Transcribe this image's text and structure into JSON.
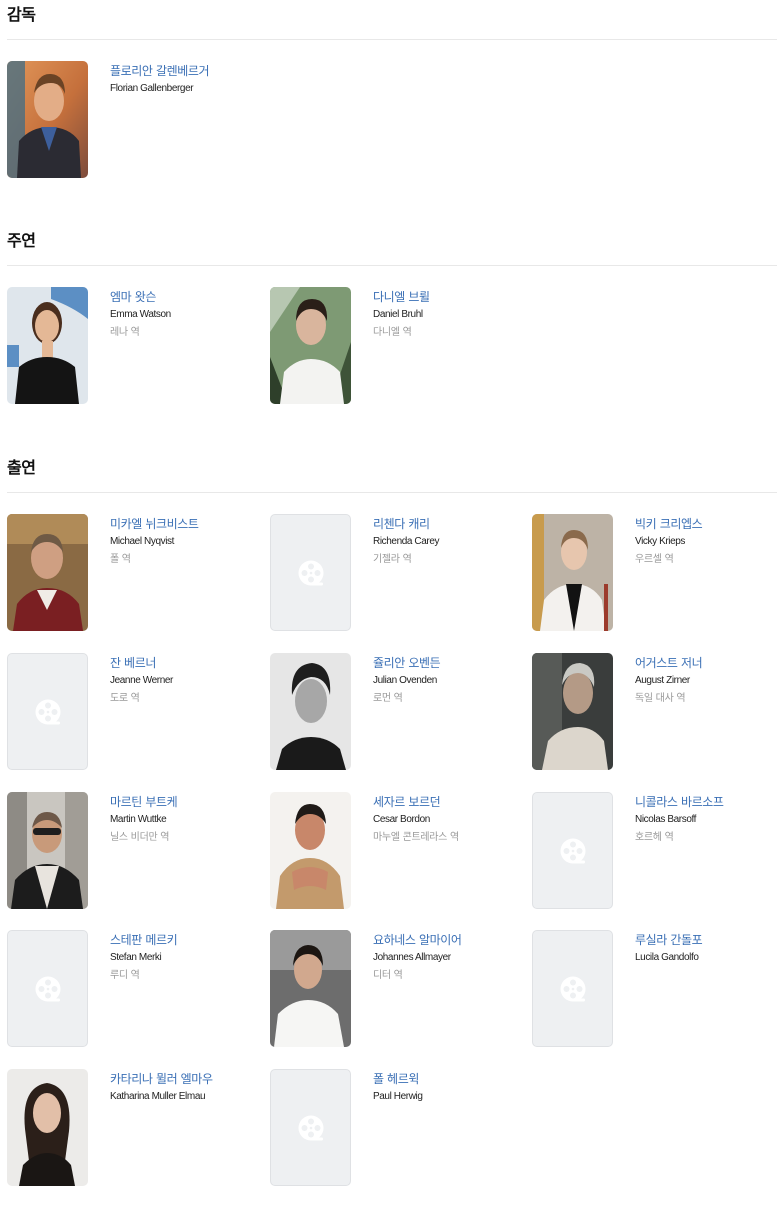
{
  "sections": {
    "director": {
      "title": "감독",
      "people": [
        {
          "name_ko": "플로리안 갈렌베르거",
          "name_en": "Florian Gallenberger",
          "role": ""
        }
      ]
    },
    "lead": {
      "title": "주연",
      "people": [
        {
          "name_ko": "엠마 왓슨",
          "name_en": "Emma Watson",
          "role": "레나 역"
        },
        {
          "name_ko": "다니엘 브륄",
          "name_en": "Daniel Bruhl",
          "role": "다니엘 역"
        }
      ]
    },
    "cast": {
      "title": "출연",
      "people": [
        {
          "name_ko": "미카엘 뉘크비스트",
          "name_en": "Michael Nyqvist",
          "role": "폴 역"
        },
        {
          "name_ko": "리첸다 캐리",
          "name_en": "Richenda Carey",
          "role": "기젤라 역"
        },
        {
          "name_ko": "빅키 크리엡스",
          "name_en": "Vicky Krieps",
          "role": "우르셀 역"
        },
        {
          "name_ko": "잔 베르너",
          "name_en": "Jeanne Werner",
          "role": "도로 역"
        },
        {
          "name_ko": "쥴리안 오벤든",
          "name_en": "Julian Ovenden",
          "role": "로먼 역"
        },
        {
          "name_ko": "어거스트 저너",
          "name_en": "August Zirner",
          "role": "독일 대사 역"
        },
        {
          "name_ko": "마르틴 부트케",
          "name_en": "Martin Wuttke",
          "role": "닐스 비더만 역"
        },
        {
          "name_ko": "세자르 보르던",
          "name_en": "Cesar Bordon",
          "role": "마누엘 콘트레라스 역"
        },
        {
          "name_ko": "니콜라스 바르소프",
          "name_en": "Nicolas Barsoff",
          "role": "호르헤 역"
        },
        {
          "name_ko": "스테판 메르키",
          "name_en": "Stefan Merki",
          "role": "루디 역"
        },
        {
          "name_ko": "요하네스 알마이어",
          "name_en": "Johannes Allmayer",
          "role": "디터 역"
        },
        {
          "name_ko": "루실라 간돌포",
          "name_en": "Lucila Gandolfo",
          "role": ""
        },
        {
          "name_ko": "카타리나 뮐러 엘마우",
          "name_en": "Katharina Muller Elmau",
          "role": ""
        },
        {
          "name_ko": "폴 헤르윅",
          "name_en": "Paul Herwig",
          "role": ""
        }
      ]
    }
  }
}
